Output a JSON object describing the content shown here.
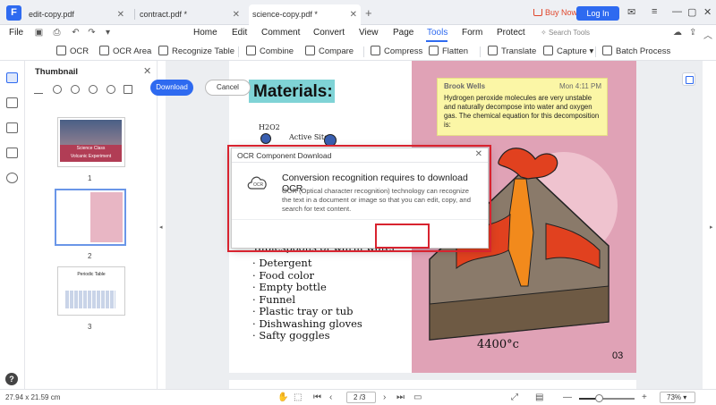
{
  "tabs": [
    {
      "label": "edit-copy.pdf",
      "active": false
    },
    {
      "label": "contract.pdf *",
      "active": false
    },
    {
      "label": "science-copy.pdf *",
      "active": true
    }
  ],
  "header": {
    "buy_now": "Buy Now",
    "login": "Log In"
  },
  "menu": {
    "file": "File",
    "items": [
      "Home",
      "Edit",
      "Comment",
      "Convert",
      "View",
      "Page",
      "Tools",
      "Form",
      "Protect"
    ],
    "active": "Tools",
    "search_placeholder": "Search Tools"
  },
  "toolbar": {
    "items": [
      "OCR",
      "OCR Area",
      "Recognize Table",
      "Combine",
      "Compare",
      "Compress",
      "Flatten",
      "Translate",
      "Capture",
      "Batch Process"
    ]
  },
  "thumbnail_panel": {
    "title": "Thumbnail",
    "pages": [
      {
        "number": "1",
        "title_line1": "Science Class",
        "title_line2": "Volcanic Experiment"
      },
      {
        "number": "2"
      },
      {
        "number": "3",
        "title": "Periodic Table"
      }
    ]
  },
  "document": {
    "heading": "Materials:",
    "diagram_label_1": "H2O2",
    "diagram_label_2": "Active Site",
    "list_partial": "Tablespoons of warm water",
    "list": [
      "Detergent",
      "Food color",
      "Empty bottle",
      "Funnel",
      "Plastic tray or tub",
      "Dishwashing gloves",
      "Safty goggles"
    ],
    "note": {
      "author": "Brook Wells",
      "time": "Mon 4:11 PM",
      "text": "Hydrogen peroxide molecules are very unstable and naturally decompose into water and oxygen gas. The chemical equation for this decomposition is:"
    },
    "temperature": "4400°c",
    "page_label": "03"
  },
  "dialog": {
    "title": "OCR Component Download",
    "heading": "Conversion recognition requires to download OCR",
    "body": "OCR (Optical character recognition) technology can recognize the text in a document or image so that you can edit, copy, and search for text content.",
    "icon_label": "OCR",
    "download": "Download",
    "cancel": "Cancel"
  },
  "status": {
    "page_size": "27.94 x 21.59 cm",
    "page_indicator": "2 /3",
    "zoom_level": 0.35,
    "zoom": "73%"
  },
  "colors": {
    "accent": "#2e6af0",
    "highlight": "#d8232f",
    "note_bg": "#fbf6a6",
    "page_pink": "#e0a2b6",
    "heading_bg": "#7fd3d6"
  }
}
